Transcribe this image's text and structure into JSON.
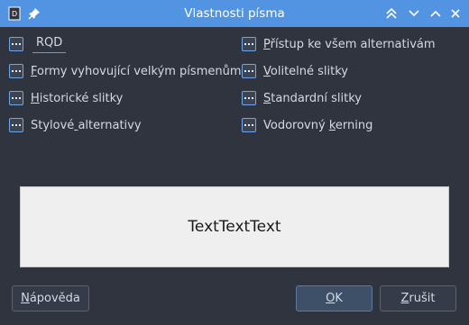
{
  "window": {
    "title": "Vlastnosti písma",
    "title_icon": "font-dialog-icon",
    "pin_icon": "pin-icon",
    "controls": [
      "keep-above-icon",
      "keep-below-icon",
      "minimize-icon",
      "close-icon"
    ]
  },
  "features": {
    "left": [
      {
        "label": "RQD",
        "mnemonic_index": -1
      },
      {
        "label": "Formy vyhovující velkým písmenům",
        "mnemonic_index": 0
      },
      {
        "label": "Historické slitky",
        "mnemonic_index": 0
      },
      {
        "label": "Stylové alternativy",
        "mnemonic_index": 7
      }
    ],
    "right": [
      {
        "label": "Přístup ke všem alternativám",
        "mnemonic_index": 0
      },
      {
        "label": "Volitelné slitky",
        "mnemonic_index": 0
      },
      {
        "label": "Standardní slitky",
        "mnemonic_index": 0
      },
      {
        "label": "Vodorovný kerning",
        "mnemonic_index": 10
      }
    ]
  },
  "preview": {
    "text": "TextTextText"
  },
  "buttons": {
    "help": "Nápověda",
    "ok": "OK",
    "cancel": "Zrušit"
  },
  "colors": {
    "titlebar": "#5294e2",
    "window_bg": "#2f343f",
    "preview_bg": "#efefef"
  }
}
